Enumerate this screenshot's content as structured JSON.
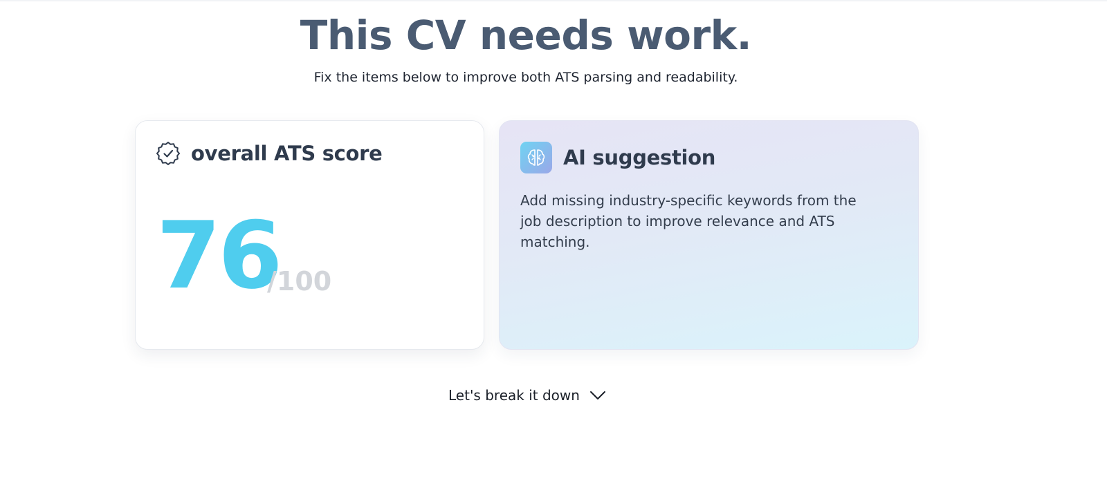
{
  "header": {
    "title": "This CV needs work.",
    "subtitle": "Fix the items below to improve both ATS parsing and readability."
  },
  "score_card": {
    "title": "overall ATS score",
    "icon": "verified-badge-icon",
    "score": "76",
    "max": "/100",
    "score_color": "#4fcdee"
  },
  "ai_card": {
    "title": "AI suggestion",
    "icon": "ai-brain-icon",
    "text": "Add missing industry-specific keywords from the job description to improve relevance and ATS matching."
  },
  "breakdown": {
    "label": "Let's break it down",
    "icon": "chevron-down-icon"
  }
}
